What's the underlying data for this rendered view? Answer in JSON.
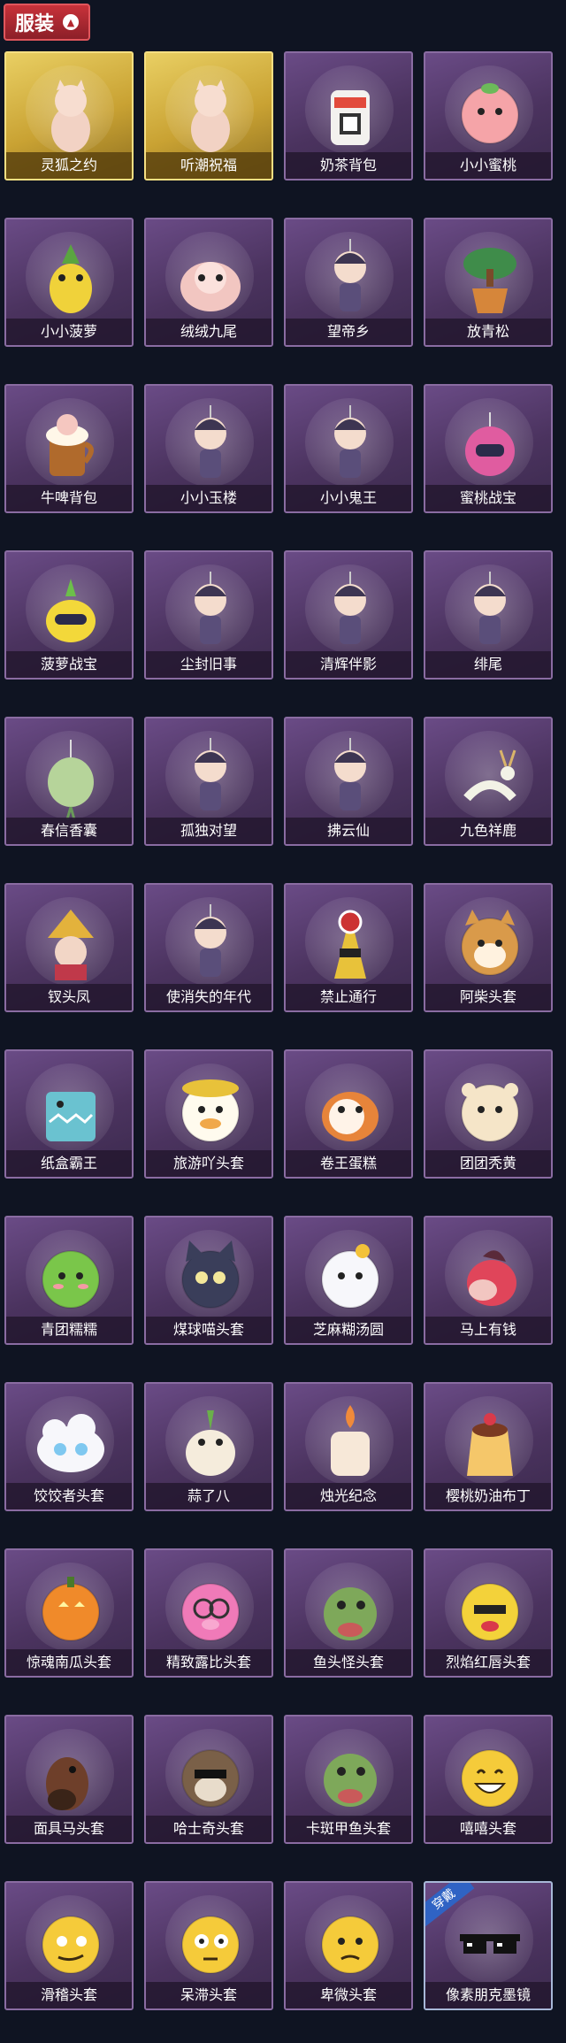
{
  "header": {
    "tab_label": "服装",
    "tab_icon": "chevron-up-icon"
  },
  "colors": {
    "tab": "#b3272f",
    "card": "#5b3f73",
    "gold": "#d4ad3a",
    "badge": "#2f63c4"
  },
  "items": [
    {
      "label": "灵狐之约",
      "icon": "fox-figure-icon",
      "gold": true
    },
    {
      "label": "听潮祝福",
      "icon": "winged-figure-icon",
      "gold": true
    },
    {
      "label": "奶茶背包",
      "icon": "milk-tea-bag-icon"
    },
    {
      "label": "小小蜜桃",
      "icon": "peach-icon"
    },
    {
      "label": "小小菠萝",
      "icon": "pineapple-icon"
    },
    {
      "label": "绒绒九尾",
      "icon": "nine-tail-fox-icon"
    },
    {
      "label": "望帝乡",
      "icon": "chibi-character-icon"
    },
    {
      "label": "放青松",
      "icon": "pine-tree-pot-icon"
    },
    {
      "label": "牛啤背包",
      "icon": "beer-mug-icon"
    },
    {
      "label": "小小玉楼",
      "icon": "chibi-pendant-icon"
    },
    {
      "label": "小小鬼王",
      "icon": "chibi-pendant-icon"
    },
    {
      "label": "蜜桃战宝",
      "icon": "pink-robot-icon"
    },
    {
      "label": "菠萝战宝",
      "icon": "yellow-robot-icon"
    },
    {
      "label": "尘封旧事",
      "icon": "chibi-pendant-icon"
    },
    {
      "label": "清辉伴影",
      "icon": "chibi-pendant-icon"
    },
    {
      "label": "绯尾",
      "icon": "chibi-pendant-icon"
    },
    {
      "label": "春信香囊",
      "icon": "sachet-icon"
    },
    {
      "label": "孤独对望",
      "icon": "chibi-pendant-icon"
    },
    {
      "label": "拂云仙",
      "icon": "chibi-pendant-icon"
    },
    {
      "label": "九色祥鹿",
      "icon": "deer-icon"
    },
    {
      "label": "钗头凤",
      "icon": "phoenix-crown-icon"
    },
    {
      "label": "使消失的年代",
      "icon": "chibi-character-icon"
    },
    {
      "label": "禁止通行",
      "icon": "traffic-cone-icon"
    },
    {
      "label": "阿柴头套",
      "icon": "shiba-head-icon"
    },
    {
      "label": "纸盒霸王",
      "icon": "dino-box-icon"
    },
    {
      "label": "旅游吖头套",
      "icon": "duck-hat-icon"
    },
    {
      "label": "卷王蛋糕",
      "icon": "cake-roll-icon"
    },
    {
      "label": "团团秃黄",
      "icon": "hamster-head-icon"
    },
    {
      "label": "青团糯糯",
      "icon": "green-mochi-icon"
    },
    {
      "label": "煤球喵头套",
      "icon": "cat-head-icon"
    },
    {
      "label": "芝麻糊汤圆",
      "icon": "dumpling-head-icon"
    },
    {
      "label": "马上有钱",
      "icon": "horse-head-icon"
    },
    {
      "label": "饺饺者头套",
      "icon": "dumpling-cloud-icon"
    },
    {
      "label": "蒜了八",
      "icon": "garlic-icon"
    },
    {
      "label": "烛光纪念",
      "icon": "candle-icon"
    },
    {
      "label": "樱桃奶油布丁",
      "icon": "pudding-icon"
    },
    {
      "label": "惊魂南瓜头套",
      "icon": "pumpkin-icon"
    },
    {
      "label": "精致露比头套",
      "icon": "pink-pig-icon"
    },
    {
      "label": "鱼头怪头套",
      "icon": "fish-head-icon"
    },
    {
      "label": "烈焰红唇头套",
      "icon": "yellow-creature-icon"
    },
    {
      "label": "面具马头套",
      "icon": "brown-horse-icon"
    },
    {
      "label": "哈士奇头套",
      "icon": "husky-head-icon"
    },
    {
      "label": "卡斑甲鱼头套",
      "icon": "fish-head-icon"
    },
    {
      "label": "嘻嘻头套",
      "icon": "grin-emoji-icon"
    },
    {
      "label": "滑稽头套",
      "icon": "smirk-emoji-icon"
    },
    {
      "label": "呆滞头套",
      "icon": "stare-emoji-icon"
    },
    {
      "label": "卑微头套",
      "icon": "sad-emoji-icon"
    },
    {
      "label": "像素朋克墨镜",
      "icon": "pixel-sunglasses-icon",
      "equipped": true,
      "badge": "穿戴"
    }
  ]
}
